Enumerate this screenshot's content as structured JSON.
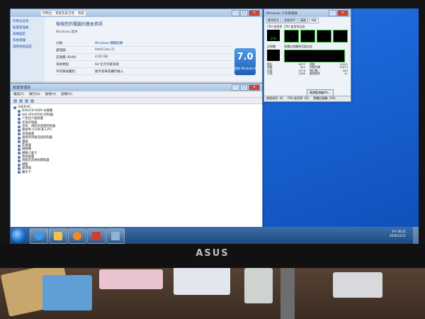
{
  "system": {
    "breadcrumb": "控制台 › 系統及安全性 › 系統",
    "heading": "檢視您的電腦的基本資訊",
    "edition_line": "Windows 版本",
    "sidebar_links": [
      "控制台首頁",
      "裝置管理員",
      "遠端設定",
      "系統保護",
      "進階系統設定"
    ],
    "rows": [
      {
        "label": "分級:",
        "value": "Windows 體驗指數"
      },
      {
        "label": "處理器:",
        "value": "Intel Core i5"
      },
      {
        "label": "記憶體 (RAM):",
        "value": "4.00 GB"
      },
      {
        "label": "系統類型:",
        "value": "64 位元作業系統"
      },
      {
        "label": "手寫筆與觸控:",
        "value": "無手寫筆或觸控輸入"
      }
    ],
    "score": "7.0",
    "score_caption": "您的 Windows 體驗指數"
  },
  "device_manager": {
    "title": "裝置管理員",
    "menu": [
      "檔案(F)",
      "執行(A)",
      "檢視(V)",
      "說明(H)"
    ],
    "root": "USER-PC",
    "items": [
      "DVD/CD-ROM 光碟機",
      "IDE ATA/ATAPI 控制器",
      "人性化介面裝置",
      "存放控制器",
      "音效、視訊及遊戲控制器",
      "連接埠 (COM 和 LPT)",
      "其他裝置",
      "通用序列匯流排控制器",
      "電腦",
      "監視器",
      "磁碟機",
      "網路介面卡",
      "系統裝置",
      "滑鼠及其他指標裝置",
      "鍵盤",
      "處理器",
      "顯示卡"
    ]
  },
  "task_manager": {
    "title": "Windows 工作管理員",
    "tabs": [
      "應用程式",
      "處理程序",
      "服務",
      "效能",
      "網路功能",
      "使用者"
    ],
    "cpu_label": "CPU 使用率",
    "cpu_history_label": "CPU 使用率記錄",
    "cpu_value": "0 %",
    "mem_label": "記憶體",
    "mem_history_label": "實體記憶體使用量記錄",
    "stats": [
      [
        "總計",
        "4077"
      ],
      [
        "快取",
        "901"
      ],
      [
        "可用",
        "3276"
      ],
      [
        "可用",
        "2485"
      ],
      [
        "系統",
        "00:01"
      ],
      [
        "控制代碼",
        "13974"
      ],
      [
        "執行緒",
        "584"
      ],
      [
        "處理程序",
        "41"
      ]
    ],
    "resource_button": "資源監視器(R)...",
    "status": [
      "處理程序: 41",
      "CPU 使用率: 0%",
      "實體記憶體: 19%"
    ]
  },
  "taskbar": {
    "time": "下午 06:21",
    "date": "2016/12/11",
    "buttons_icons": [
      "ie-icon",
      "folder-icon",
      "media-icon",
      "task-manager-icon",
      "device-manager-icon"
    ]
  },
  "bezel": {
    "brand": "ASUS"
  }
}
